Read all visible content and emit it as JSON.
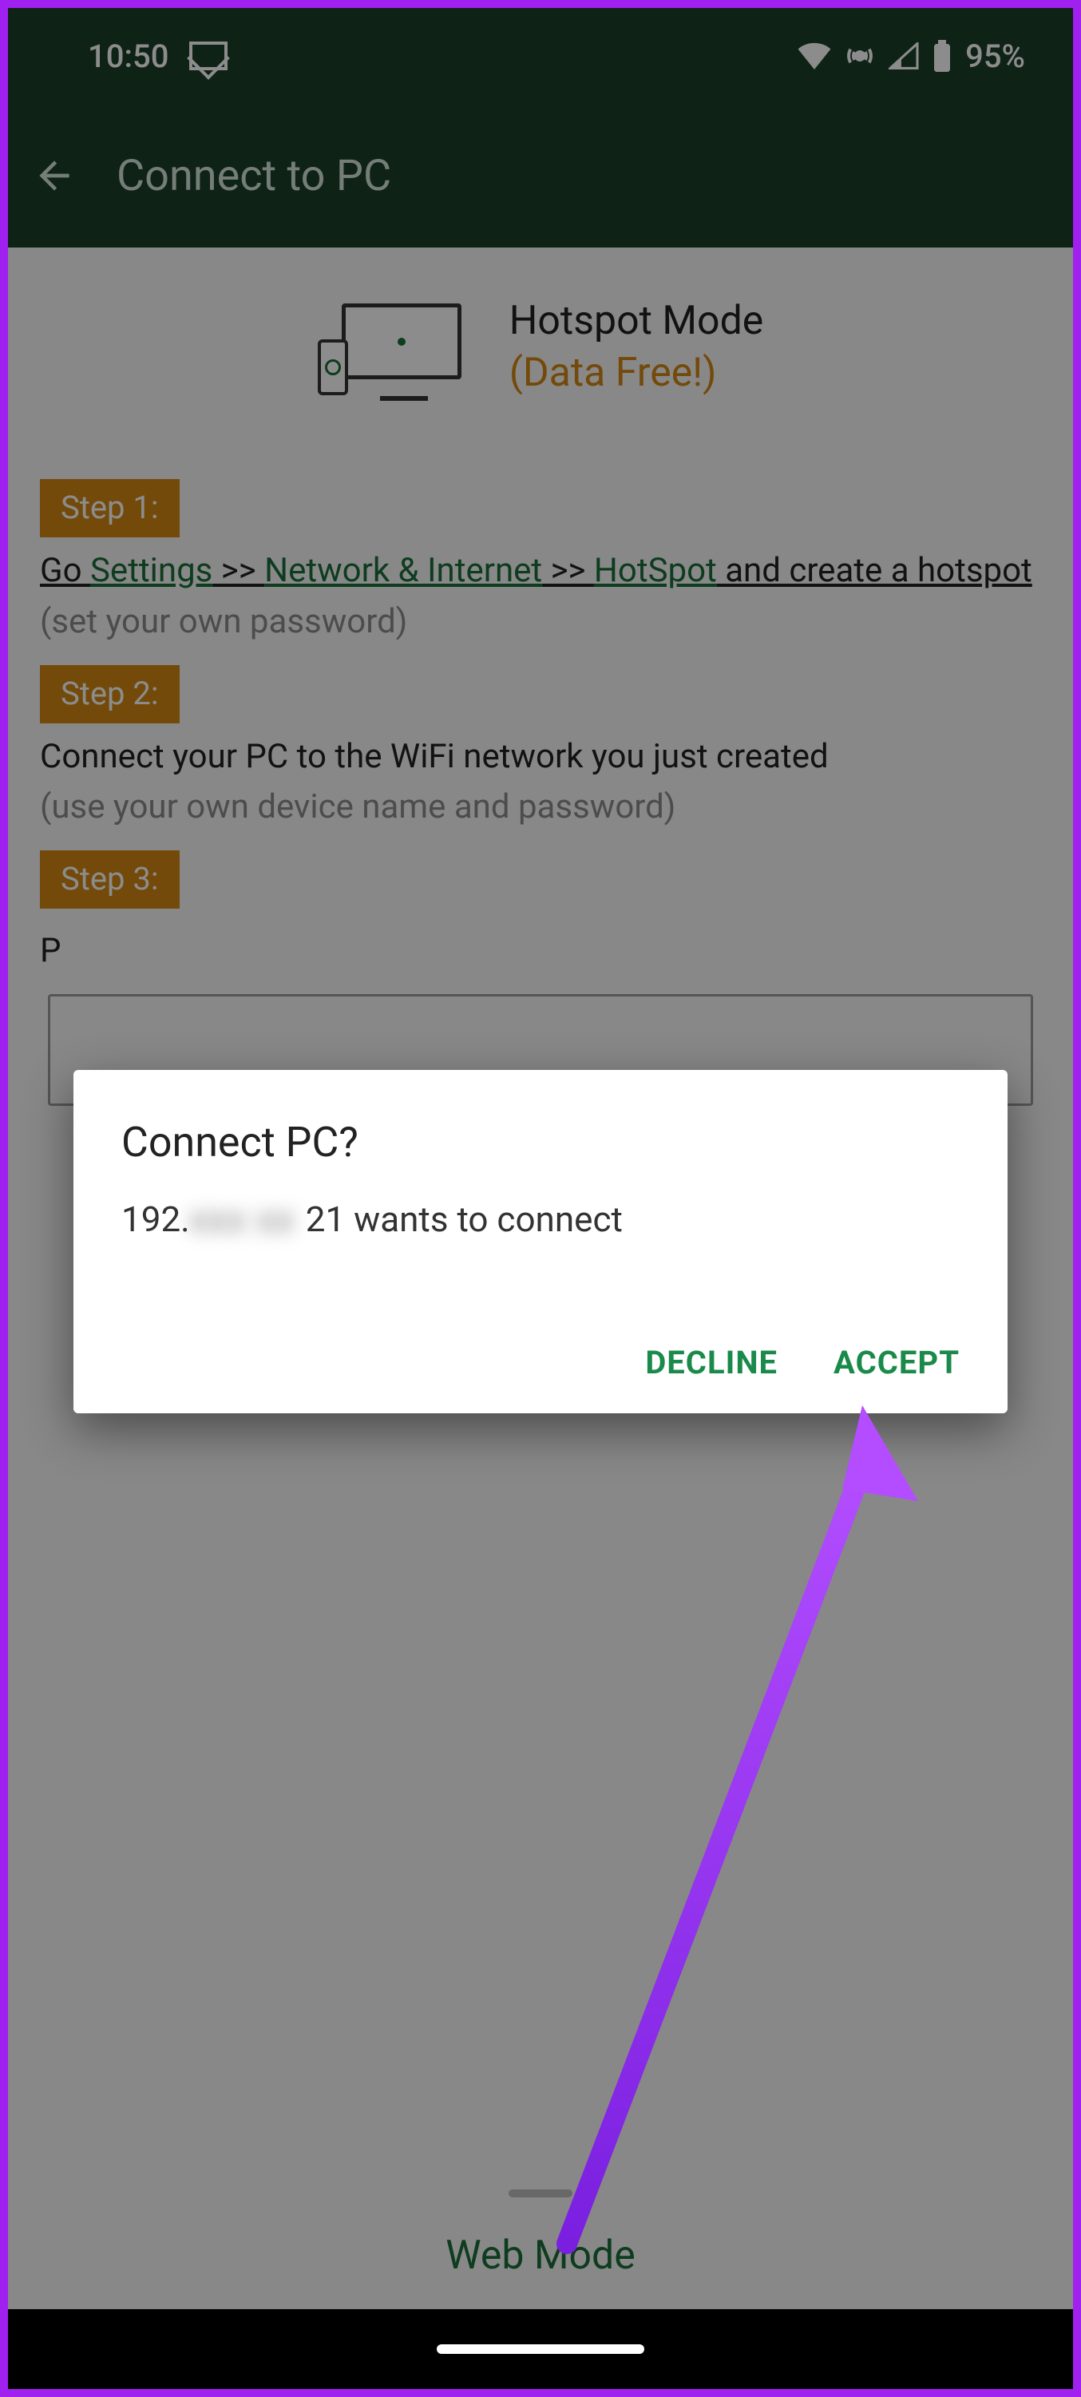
{
  "status": {
    "time": "10:50",
    "battery": "95%"
  },
  "appbar": {
    "title": "Connect to PC"
  },
  "hotspot": {
    "title": "Hotspot Mode",
    "subtitle": "(Data Free!)"
  },
  "steps": {
    "s1_label": "Step 1:",
    "s1_go": "Go ",
    "s1_settings": "Settings",
    "s1_sep1": " >> ",
    "s1_network": "Network & Internet",
    "s1_sep2": " >> ",
    "s1_hotspot": "HotSpot",
    "s1_tail": " and create a hotspot",
    "s1_hint": "(set your own password)",
    "s2_label": "Step 2:",
    "s2_text": "Connect your PC to the WiFi network you just created",
    "s2_hint": "(use your own device name and password)",
    "s3_label": "Step 3:",
    "s3_partial": "P"
  },
  "web_mode_label": "Web Mode",
  "dialog": {
    "title": "Connect PC?",
    "ip_prefix": "192.",
    "ip_blurred": "xxx xx ",
    "ip_suffix": "21 wants to connect",
    "decline": "DECLINE",
    "accept": "ACCEPT"
  }
}
